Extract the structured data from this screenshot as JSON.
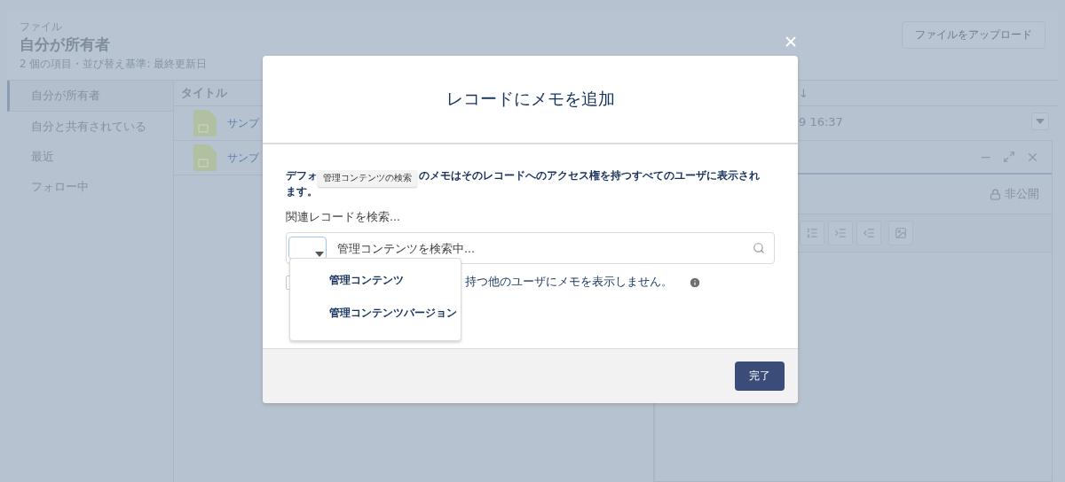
{
  "page": {
    "breadcrumb": "ファイル",
    "title": "自分が所有者",
    "subtitle": "2 個の項目・並び替え基準: 最終更新日",
    "upload_button": "ファイルをアップロード"
  },
  "sidebar": {
    "items": [
      {
        "label": "自分が所有者",
        "selected": true
      },
      {
        "label": "自分と共有されている",
        "selected": false
      },
      {
        "label": "最近",
        "selected": false
      },
      {
        "label": "フォロー中",
        "selected": false
      }
    ]
  },
  "table": {
    "columns": [
      "タイトル"
    ],
    "rows": [
      {
        "title": "サンプ"
      },
      {
        "title": "サンプ"
      }
    ]
  },
  "detail": {
    "sort_arrow": "↓",
    "date": "9 16:37",
    "note_panel": {
      "privacy": "非公開"
    }
  },
  "modal": {
    "title": "レコードにメモを追加",
    "notice": [
      "デフォ",
      "のメモはそのレコードへのアクセス権を持つすべてのユーザに表示され",
      "ます。"
    ],
    "tooltip": "管理コンテンツの検索",
    "search_label": "関連レコードを検索...",
    "search": {
      "placeholder": "管理コンテンツを検索中..."
    },
    "object_menu": {
      "expanded": true,
      "options": [
        {
          "label": "管理コンテンツ",
          "selected": false
        },
        {
          "label": "管理コンテンツバージョン",
          "selected": false
        }
      ]
    },
    "private_option": {
      "label": "持つ他のユーザにメモを表示しません。",
      "checked": false
    },
    "done_button": "完了"
  }
}
